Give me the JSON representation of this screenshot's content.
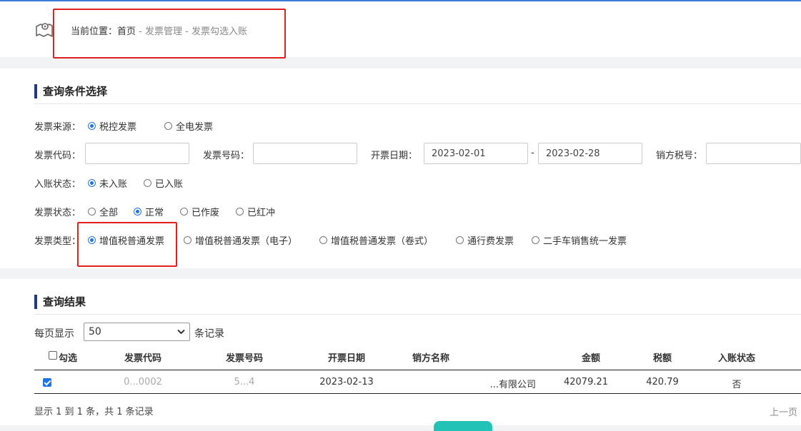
{
  "breadcrumb": {
    "prefix": "当前位置：",
    "home": "首页",
    "sep1": " - ",
    "level2": "发票管理",
    "sep2": " - ",
    "current": "发票勾选入账"
  },
  "query_section": {
    "title": "查询条件选择",
    "source": {
      "label": "发票来源：",
      "options": [
        "税控发票",
        "全电发票"
      ],
      "selected": "税控发票"
    },
    "invoice_code": {
      "label": "发票代码：",
      "value": ""
    },
    "invoice_number": {
      "label": "发票号码：",
      "value": ""
    },
    "issue_date": {
      "label": "开票日期：",
      "start": "2023-02-01",
      "range_sep": "-",
      "end": "2023-02-28"
    },
    "seller_tax_id": {
      "label": "销方税号：",
      "value": ""
    },
    "entry_status": {
      "label": "入账状态：",
      "options": [
        "未入账",
        "已入账"
      ],
      "selected": "未入账"
    },
    "invoice_status": {
      "label": "发票状态：",
      "options": [
        "全部",
        "正常",
        "已作废",
        "已红冲"
      ],
      "selected": "正常"
    },
    "invoice_type": {
      "label": "发票类型：",
      "options": [
        "增值税普通发票",
        "增值税普通发票（电子）",
        "增值税普通发票（卷式）",
        "通行费发票",
        "二手车销售统一发票"
      ],
      "selected": "增值税普通发票"
    }
  },
  "results_section": {
    "title": "查询结果",
    "per_page_label": "每页显示",
    "per_page_value": "50",
    "per_page_suffix": "条记录",
    "columns": [
      "勾选",
      "发票代码",
      "发票号码",
      "开票日期",
      "销方名称",
      "金额",
      "税额",
      "入账状态"
    ],
    "rows": [
      {
        "checked": true,
        "invoice_code": "0...0002",
        "invoice_number": "5...4",
        "issue_date": "2023-02-13",
        "seller_name": "...有限公司",
        "amount": "42079.21",
        "tax": "420.79",
        "entry_status": "否"
      }
    ],
    "footer": "显示 1 到 1 条，共 1 条记录",
    "prev_page": "上一页"
  },
  "colors": {
    "accent": "#1a73e8",
    "section_bar": "#1f3a80",
    "highlight": "#e02020"
  }
}
